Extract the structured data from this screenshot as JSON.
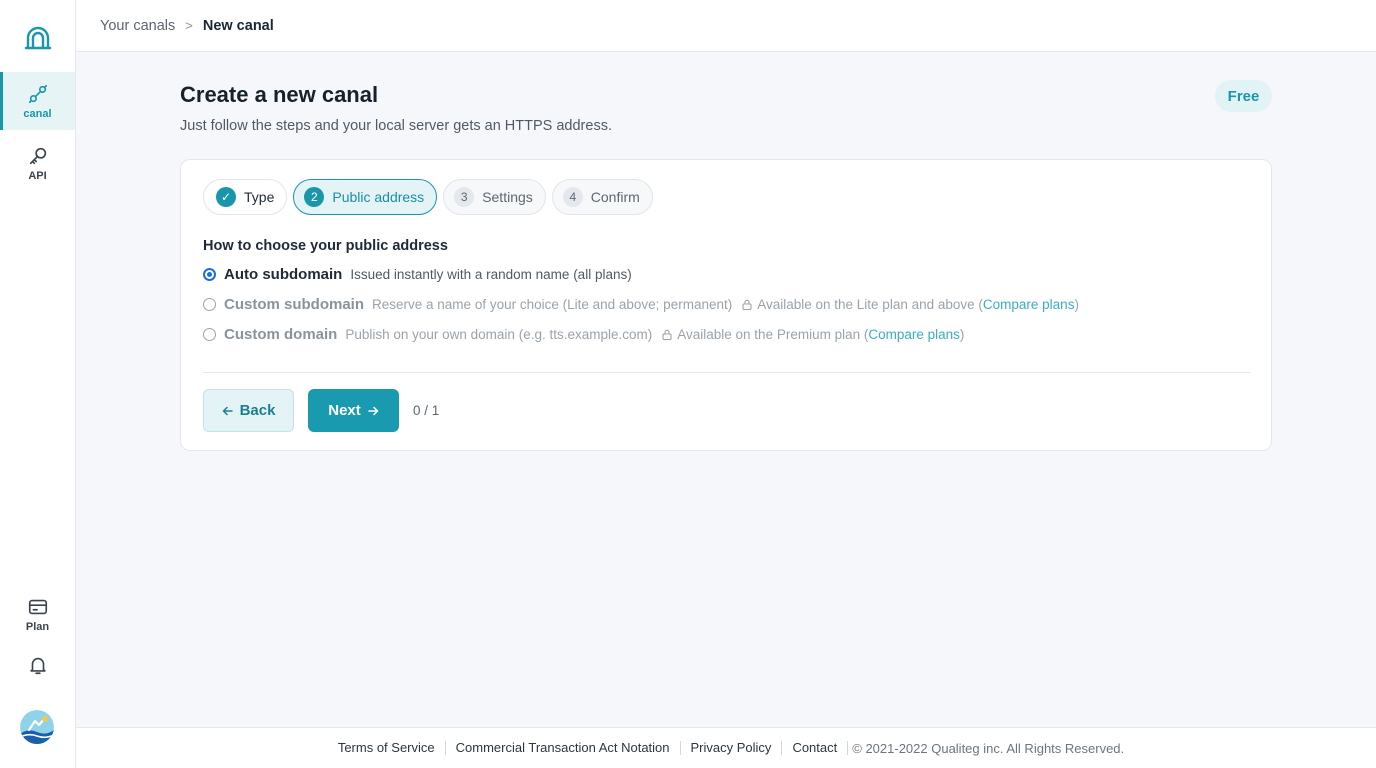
{
  "sidebar": {
    "items": [
      {
        "label": "canal"
      },
      {
        "label": "API"
      },
      {
        "label": "Plan"
      }
    ]
  },
  "breadcrumb": {
    "parent": "Your canals",
    "separator": ">",
    "current": "New canal"
  },
  "page": {
    "title": "Create a new canal",
    "subtitle": "Just follow the steps and your local server gets an HTTPS address.",
    "plan_badge": "Free"
  },
  "steps": [
    {
      "number": "✓",
      "label": "Type",
      "state": "done"
    },
    {
      "number": "2",
      "label": "Public address",
      "state": "current"
    },
    {
      "number": "3",
      "label": "Settings",
      "state": "pending"
    },
    {
      "number": "4",
      "label": "Confirm",
      "state": "pending"
    }
  ],
  "form": {
    "section_label": "How to choose your public address",
    "options": [
      {
        "name": "Auto subdomain",
        "description": "Issued instantly with a random name (all plans)",
        "selected": true
      },
      {
        "name": "Custom subdomain",
        "description": "Reserve a name of your choice (Lite and above; permanent)",
        "lock_note": "Available on the Lite plan and above (",
        "link": "Compare plans",
        "close": ")"
      },
      {
        "name": "Custom domain",
        "description": "Publish on your own domain (e.g. tts.example.com)",
        "lock_note": "Available on the Premium plan (",
        "link": "Compare plans",
        "close": ")"
      }
    ],
    "back_label": "Back",
    "next_label": "Next",
    "counter": "0 / 1"
  },
  "footer": {
    "links": [
      "Terms of Service",
      "Commercial Transaction Act Notation",
      "Privacy Policy",
      "Contact"
    ],
    "copyright": "© 2021-2022 Qualiteg inc. All Rights Reserved."
  },
  "colors": {
    "accent": "#1a96aa",
    "radio": "#1a6fe0",
    "link": "#3aaec0"
  }
}
